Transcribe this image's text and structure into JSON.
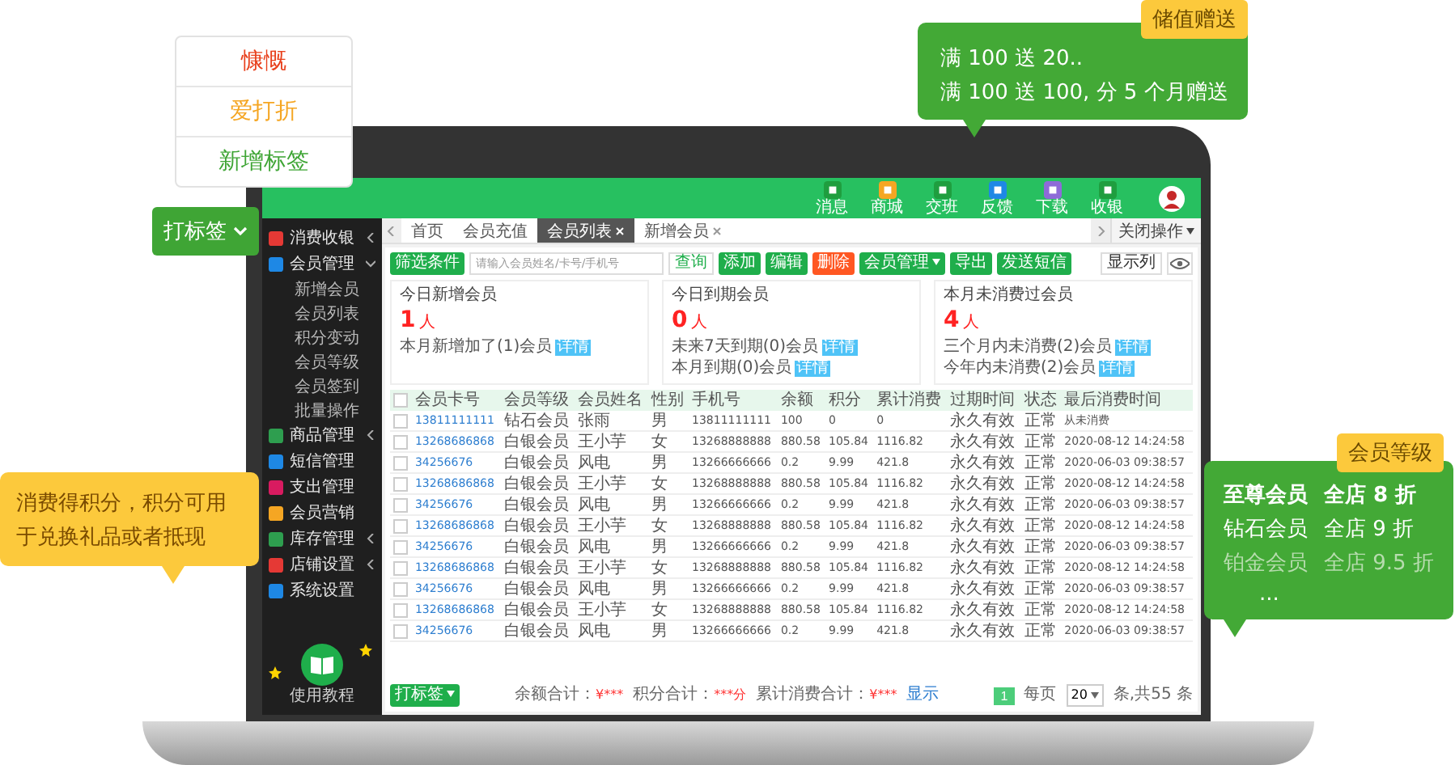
{
  "tag_menu": {
    "items": [
      {
        "label": "慷慨",
        "color": "#e8401c"
      },
      {
        "label": "爱打折",
        "color": "#f5a623"
      },
      {
        "label": "新增标签",
        "color": "#3fa535"
      }
    ],
    "button": "打标签"
  },
  "promo_callout": {
    "badge": "储值赠送",
    "lines": [
      "满 100 送 20..",
      "满 100 送 100, 分 5 个月赠送"
    ]
  },
  "points_callout": {
    "text": "消费得积分，积分可用于兑换礼品或者抵现"
  },
  "level_callout": {
    "badge": "会员等级",
    "rows": [
      {
        "tier": "至尊会员",
        "discount": "全店 8 折",
        "kind": "bold"
      },
      {
        "tier": "钻石会员",
        "discount": "全店 9 折",
        "kind": "plain"
      },
      {
        "tier": "铂金会员",
        "discount": "全店 9.5 折",
        "kind": "dim"
      }
    ],
    "more": "..."
  },
  "app": {
    "header": {
      "icons": [
        {
          "label": "消息",
          "color": "#1f9e3f"
        },
        {
          "label": "商城",
          "color": "#f5a623"
        },
        {
          "label": "交班",
          "color": "#1f9e3f"
        },
        {
          "label": "反馈",
          "color": "#1e88e5"
        },
        {
          "label": "下载",
          "color": "#8e6bd8"
        },
        {
          "label": "收银",
          "color": "#1f9e3f"
        }
      ]
    },
    "sidebar": {
      "items": [
        {
          "label": "消费收银",
          "kind": "group",
          "expanded": false,
          "color": "#e53935"
        },
        {
          "label": "会员管理",
          "kind": "group",
          "expanded": true,
          "color": "#1e88e5",
          "children": [
            {
              "label": "新增会员"
            },
            {
              "label": "会员列表"
            },
            {
              "label": "积分变动"
            },
            {
              "label": "会员等级"
            },
            {
              "label": "会员签到"
            },
            {
              "label": "批量操作"
            }
          ]
        },
        {
          "label": "商品管理",
          "kind": "group",
          "expanded": false,
          "color": "#2e9e4f"
        },
        {
          "label": "短信管理",
          "kind": "link",
          "color": "#1e88e5"
        },
        {
          "label": "支出管理",
          "kind": "link",
          "color": "#d81b60"
        },
        {
          "label": "会员营销",
          "kind": "link",
          "color": "#f5a623"
        },
        {
          "label": "库存管理",
          "kind": "group",
          "expanded": false,
          "color": "#2e9e4f"
        },
        {
          "label": "店铺设置",
          "kind": "group",
          "expanded": false,
          "color": "#e53935"
        },
        {
          "label": "系统设置",
          "kind": "link",
          "color": "#1e88e5"
        }
      ],
      "logo_caption": "使用教程"
    },
    "tabs": {
      "items": [
        {
          "label": "首页",
          "selected": false,
          "closable": false
        },
        {
          "label": "会员充值",
          "selected": false,
          "closable": false
        },
        {
          "label": "会员列表",
          "selected": true,
          "closable": true
        },
        {
          "label": "新增会员",
          "selected": false,
          "closable": true
        }
      ],
      "close_menu": "关闭操作"
    },
    "toolbar": {
      "filter": "筛选条件",
      "search_placeholder": "请输入会员姓名/卡号/手机号",
      "search": "查询",
      "actions": [
        {
          "label": "添加",
          "kind": "normal"
        },
        {
          "label": "编辑",
          "kind": "normal"
        },
        {
          "label": "删除",
          "kind": "danger"
        },
        {
          "label": "会员管理",
          "kind": "menu"
        },
        {
          "label": "导出",
          "kind": "normal"
        },
        {
          "label": "发送短信",
          "kind": "normal"
        }
      ],
      "columns_button": "显示列"
    },
    "cards": [
      {
        "title": "今日新增会员",
        "count": "1",
        "unit": "人",
        "lines": [
          {
            "text": "本月新增加了(1)会员",
            "badge": "详情"
          }
        ]
      },
      {
        "title": "今日到期会员",
        "count": "0",
        "unit": "人",
        "lines": [
          {
            "text": "未来7天到期(0)会员",
            "badge": "详情"
          },
          {
            "text": "本月到期(0)会员",
            "badge": "详情"
          }
        ]
      },
      {
        "title": "本月未消费过会员",
        "count": "4",
        "unit": "人",
        "lines": [
          {
            "text": "三个月内未消费(2)会员",
            "badge": "详情"
          },
          {
            "text": "今年内未消费(2)会员",
            "badge": "详情"
          }
        ]
      }
    ],
    "table": {
      "all_checked": false,
      "columns": [
        {
          "label": "会员卡号",
          "kind": "link"
        },
        {
          "label": "会员等级",
          "kind": "text"
        },
        {
          "label": "会员姓名",
          "kind": "text"
        },
        {
          "label": "性别",
          "kind": "text"
        },
        {
          "label": "手机号",
          "kind": "number"
        },
        {
          "label": "余额",
          "kind": "number"
        },
        {
          "label": "积分",
          "kind": "number"
        },
        {
          "label": "累计消费",
          "kind": "number"
        },
        {
          "label": "过期时间",
          "kind": "text"
        },
        {
          "label": "状态",
          "kind": "text"
        },
        {
          "label": "最后消费时间",
          "kind": "number"
        }
      ],
      "rows": [
        {
          "checked": false,
          "cells": [
            "13811111111",
            "钻石会员",
            "张雨",
            "男",
            "13811111111",
            "100",
            "0",
            "0",
            "永久有效",
            "正常",
            "从未消费"
          ]
        },
        {
          "checked": false,
          "cells": [
            "13268686868",
            "白银会员",
            "王小芋",
            "女",
            "13268888888",
            "880.58",
            "105.84",
            "1116.82",
            "永久有效",
            "正常",
            "2020-08-12 14:24:58"
          ]
        },
        {
          "checked": false,
          "cells": [
            "34256676",
            "白银会员",
            "风电",
            "男",
            "13266666666",
            "0.2",
            "9.99",
            "421.8",
            "永久有效",
            "正常",
            "2020-06-03 09:38:57"
          ]
        },
        {
          "checked": false,
          "cells": [
            "13268686868",
            "白银会员",
            "王小芋",
            "女",
            "13268888888",
            "880.58",
            "105.84",
            "1116.82",
            "永久有效",
            "正常",
            "2020-08-12 14:24:58"
          ]
        },
        {
          "checked": false,
          "cells": [
            "34256676",
            "白银会员",
            "风电",
            "男",
            "13266666666",
            "0.2",
            "9.99",
            "421.8",
            "永久有效",
            "正常",
            "2020-06-03 09:38:57"
          ]
        },
        {
          "checked": false,
          "cells": [
            "13268686868",
            "白银会员",
            "王小芋",
            "女",
            "13268888888",
            "880.58",
            "105.84",
            "1116.82",
            "永久有效",
            "正常",
            "2020-08-12 14:24:58"
          ]
        },
        {
          "checked": false,
          "cells": [
            "34256676",
            "白银会员",
            "风电",
            "男",
            "13266666666",
            "0.2",
            "9.99",
            "421.8",
            "永久有效",
            "正常",
            "2020-06-03 09:38:57"
          ]
        },
        {
          "checked": false,
          "cells": [
            "13268686868",
            "白银会员",
            "王小芋",
            "女",
            "13268888888",
            "880.58",
            "105.84",
            "1116.82",
            "永久有效",
            "正常",
            "2020-08-12 14:24:58"
          ]
        },
        {
          "checked": false,
          "cells": [
            "34256676",
            "白银会员",
            "风电",
            "男",
            "13266666666",
            "0.2",
            "9.99",
            "421.8",
            "永久有效",
            "正常",
            "2020-06-03 09:38:57"
          ]
        },
        {
          "checked": false,
          "cells": [
            "13268686868",
            "白银会员",
            "王小芋",
            "女",
            "13268888888",
            "880.58",
            "105.84",
            "1116.82",
            "永久有效",
            "正常",
            "2020-08-12 14:24:58"
          ]
        },
        {
          "checked": false,
          "cells": [
            "34256676",
            "白银会员",
            "风电",
            "男",
            "13266666666",
            "0.2",
            "9.99",
            "421.8",
            "永久有效",
            "正常",
            "2020-06-03 09:38:57"
          ]
        }
      ]
    },
    "footer": {
      "tag_button": "打标签",
      "summaries": [
        {
          "label": "余额合计：",
          "value": "¥***"
        },
        {
          "label": "积分合计：",
          "value": "***分"
        },
        {
          "label": "累计消费合计：",
          "value": "¥***"
        }
      ],
      "show_link": "显示",
      "pagination": {
        "pages": [
          {
            "label": "1",
            "selected": true
          }
        ],
        "per_page_label": "每页",
        "per_page": "20",
        "total": "条,共55 条"
      }
    }
  }
}
